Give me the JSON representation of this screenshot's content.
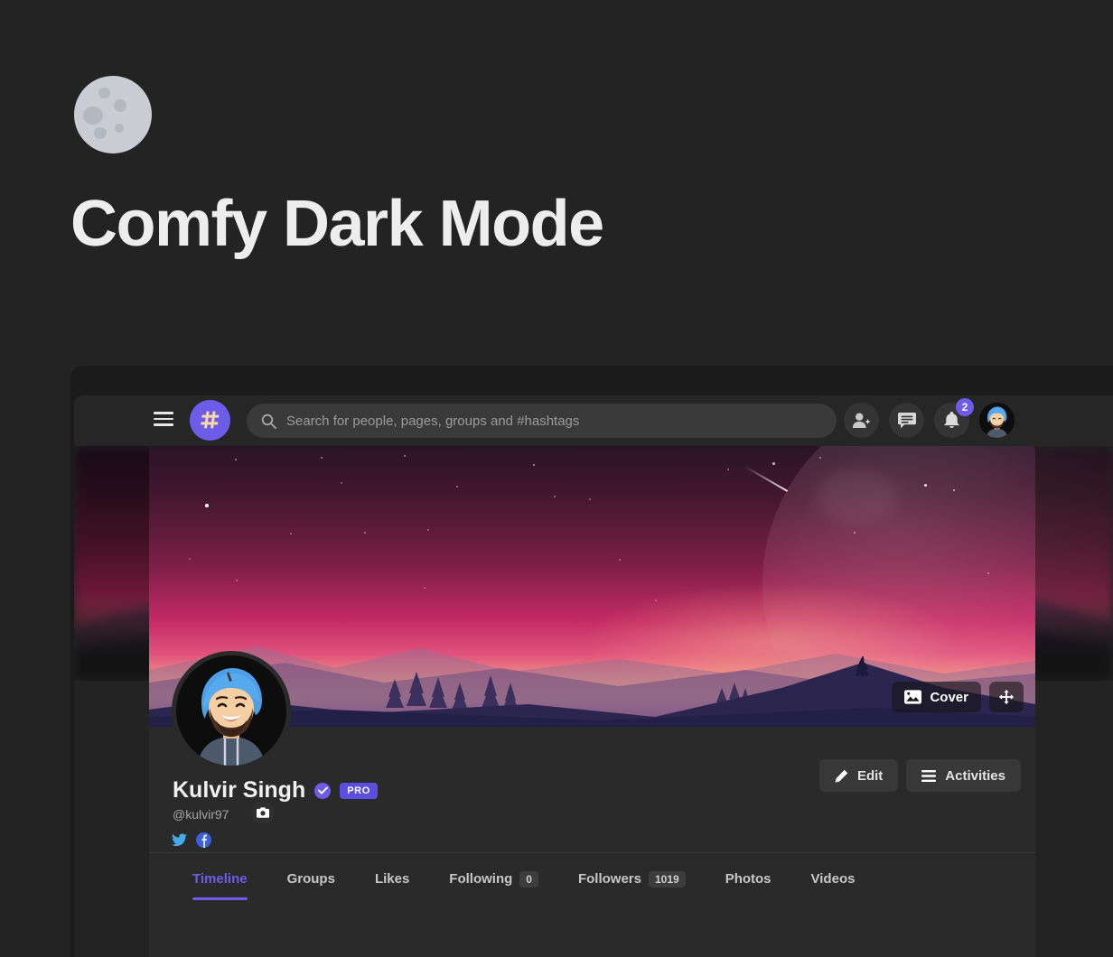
{
  "hero": {
    "title": "Comfy Dark Mode",
    "icon": "moon-icon"
  },
  "navbar": {
    "menu_icon": "hamburger-menu-icon",
    "logo_icon": "hashtag-logo-icon",
    "search": {
      "placeholder": "Search for people, pages, groups and #hashtags",
      "value": "",
      "icon": "search-icon"
    },
    "actions": [
      {
        "name": "friend-requests",
        "icon": "person-add-icon",
        "badge": ""
      },
      {
        "name": "messages",
        "icon": "chat-bubble-icon",
        "badge": ""
      },
      {
        "name": "notifications",
        "icon": "bell-icon",
        "badge": "2"
      }
    ],
    "avatar": {
      "name": "user-avatar",
      "alt": "Kulvir Singh"
    }
  },
  "cover": {
    "alt": "Night landscape with large moon, mountains and howling wolf",
    "buttons": [
      {
        "label": "Cover",
        "icon": "image-icon"
      },
      {
        "label": "",
        "icon": "move-arrows-icon"
      }
    ]
  },
  "profile": {
    "avatar_alt": "Kulvir Singh profile photo",
    "camera_icon": "camera-icon",
    "name": "Kulvir Singh",
    "verified_icon": "verified-check-icon",
    "pro_badge": "PRO",
    "handle": "@kulvir97",
    "socials": [
      {
        "name": "twitter",
        "icon": "twitter-icon"
      },
      {
        "name": "facebook",
        "icon": "facebook-icon"
      }
    ],
    "buttons": [
      {
        "label": "Edit",
        "icon": "pencil-icon"
      },
      {
        "label": "Activities",
        "icon": "list-icon"
      }
    ]
  },
  "tabs": [
    {
      "label": "Timeline",
      "count": null,
      "active": true
    },
    {
      "label": "Groups",
      "count": null,
      "active": false
    },
    {
      "label": "Likes",
      "count": null,
      "active": false
    },
    {
      "label": "Following",
      "count": "0",
      "active": false
    },
    {
      "label": "Followers",
      "count": "1019",
      "active": false
    },
    {
      "label": "Photos",
      "count": null,
      "active": false
    },
    {
      "label": "Videos",
      "count": null,
      "active": false
    }
  ],
  "colors": {
    "page_bg": "#232323",
    "accent": "#6c5ce7",
    "card_bg": "#2a2a2a",
    "nav_bg": "#262626",
    "text": "#ededed"
  }
}
